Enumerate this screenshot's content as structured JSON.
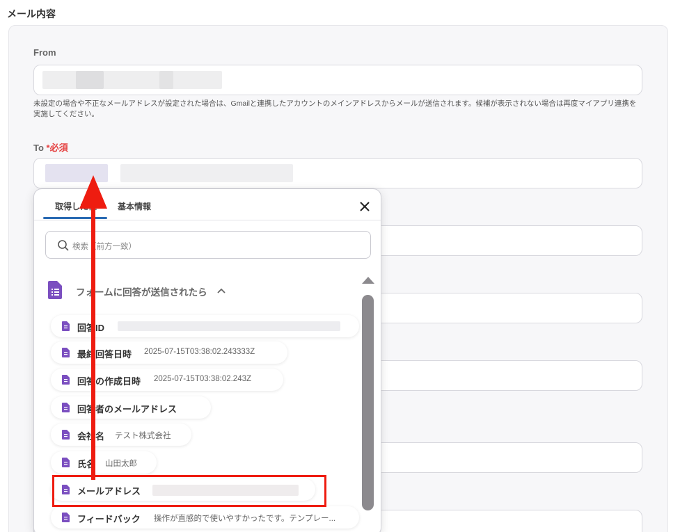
{
  "section": {
    "title": "メール内容"
  },
  "from": {
    "label": "From",
    "help": "未設定の場合や不正なメールアドレスが設定された場合は、Gmailと連携したアカウントのメインアドレスからメールが送信されます。候補が表示されない場合は再度マイアプリ連携を実施してください。"
  },
  "to": {
    "label": "To",
    "required_mark": "*",
    "required_text": "必須"
  },
  "popup": {
    "tabs": [
      {
        "label": "取得した値"
      },
      {
        "label": "基本情報"
      }
    ],
    "search_placeholder": "検索（前方一致）",
    "group_title": "フォームに回答が送信されたら",
    "items": [
      {
        "name": "回答ID",
        "value": ""
      },
      {
        "name": "最終回答日時",
        "value": "2025-07-15T03:38:02.243333Z"
      },
      {
        "name": "回答の作成日時",
        "value": "2025-07-15T03:38:02.243Z"
      },
      {
        "name": "回答者のメールアドレス",
        "value": ""
      },
      {
        "name": "会社名",
        "value": "テスト株式会社"
      },
      {
        "name": "氏名",
        "value": "山田太郎"
      },
      {
        "name": "メールアドレス",
        "value": ""
      },
      {
        "name": "フィードバック",
        "value": "操作が直感的で使いやすかったです。テンプレー..."
      }
    ]
  },
  "colors": {
    "accent": "#2a6bb3",
    "required": "#e54040",
    "highlight": "#ee1c10",
    "form_icon": "#7b4fc0"
  },
  "icons": {
    "close": "close-icon",
    "search": "search-icon",
    "form": "form-icon",
    "chevron": "chevron-up-icon"
  }
}
